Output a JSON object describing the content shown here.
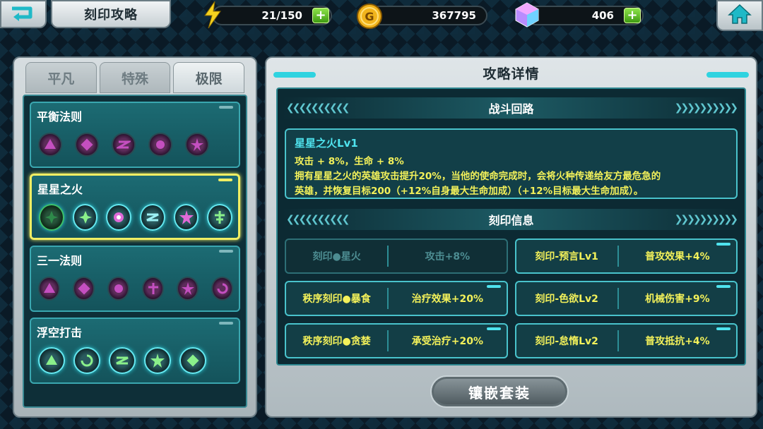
{
  "header": {
    "title": "刻印攻略",
    "energy": "21/150",
    "gold": "367795",
    "gems": "406",
    "plus_label": "+"
  },
  "left": {
    "tabs": [
      {
        "label": "平凡",
        "active": false
      },
      {
        "label": "特殊",
        "active": false
      },
      {
        "label": "极限",
        "active": true
      }
    ],
    "sets": [
      {
        "name": "平衡法则"
      },
      {
        "name": "星星之火"
      },
      {
        "name": "三一法则"
      },
      {
        "name": "浮空打击"
      }
    ]
  },
  "right": {
    "title": "攻略详情",
    "section1": "战斗回路",
    "desc": {
      "title": "星星之火Lv1",
      "line1": "攻击 + 8%，生命 + 8%",
      "line2": "拥有星星之火的英雄攻击提升20%，当他的使命完成时，会将火种传递给友方最危急的",
      "line3": "英雄，并恢复目标200（+12%自身最大生命加成）（+12%目标最大生命加成）。"
    },
    "section2": "刻印信息",
    "runes": [
      {
        "name": "刻印●星火",
        "value": "攻击+8%"
      },
      {
        "name": "刻印-预言Lv1",
        "value": "普攻效果+4%"
      },
      {
        "name": "秩序刻印●暴食",
        "value": "治疗效果+20%"
      },
      {
        "name": "刻印-色欲Lv2",
        "value": "机械伤害+9%"
      },
      {
        "name": "秩序刻印●贪婪",
        "value": "承受治疗+20%"
      },
      {
        "name": "刻印-怠惰Lv2",
        "value": "普攻抵抗+4%"
      }
    ],
    "equip_button": "镶嵌套装"
  },
  "colors": {
    "accent": "#4fe3ee",
    "highlight": "#f3f15a",
    "selected_border": "#f0ee63"
  }
}
